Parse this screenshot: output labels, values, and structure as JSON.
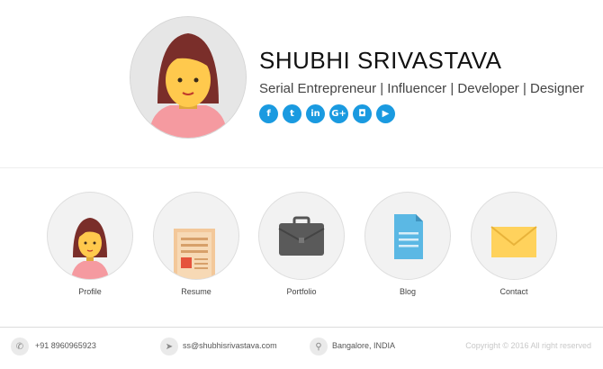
{
  "profile": {
    "name": "SHUBHI SRIVASTAVA",
    "tagline": "Serial Entrepreneur | Influencer | Developer | Designer"
  },
  "socials": [
    {
      "name": "facebook",
      "glyph": "f"
    },
    {
      "name": "twitter",
      "glyph": "t"
    },
    {
      "name": "linkedin",
      "glyph": "in"
    },
    {
      "name": "google-plus",
      "glyph": "G+"
    },
    {
      "name": "instagram",
      "glyph": "◘"
    },
    {
      "name": "youtube",
      "glyph": "▶"
    }
  ],
  "nav": [
    {
      "label": "Profile",
      "icon": "person-icon"
    },
    {
      "label": "Resume",
      "icon": "document-icon"
    },
    {
      "label": "Portfolio",
      "icon": "briefcase-icon"
    },
    {
      "label": "Blog",
      "icon": "file-icon"
    },
    {
      "label": "Contact",
      "icon": "envelope-icon"
    }
  ],
  "footer": {
    "phone": "+91 8960965923",
    "email": "ss@shubhisrivastava.com",
    "location": "Bangalore, INDIA",
    "copyright": "Copyright © 2016 All right reserved"
  },
  "colors": {
    "social_blue": "#1a9ae0",
    "skin": "#ffc94d",
    "hair": "#7a2e2a",
    "shirt": "#f59aa0"
  }
}
